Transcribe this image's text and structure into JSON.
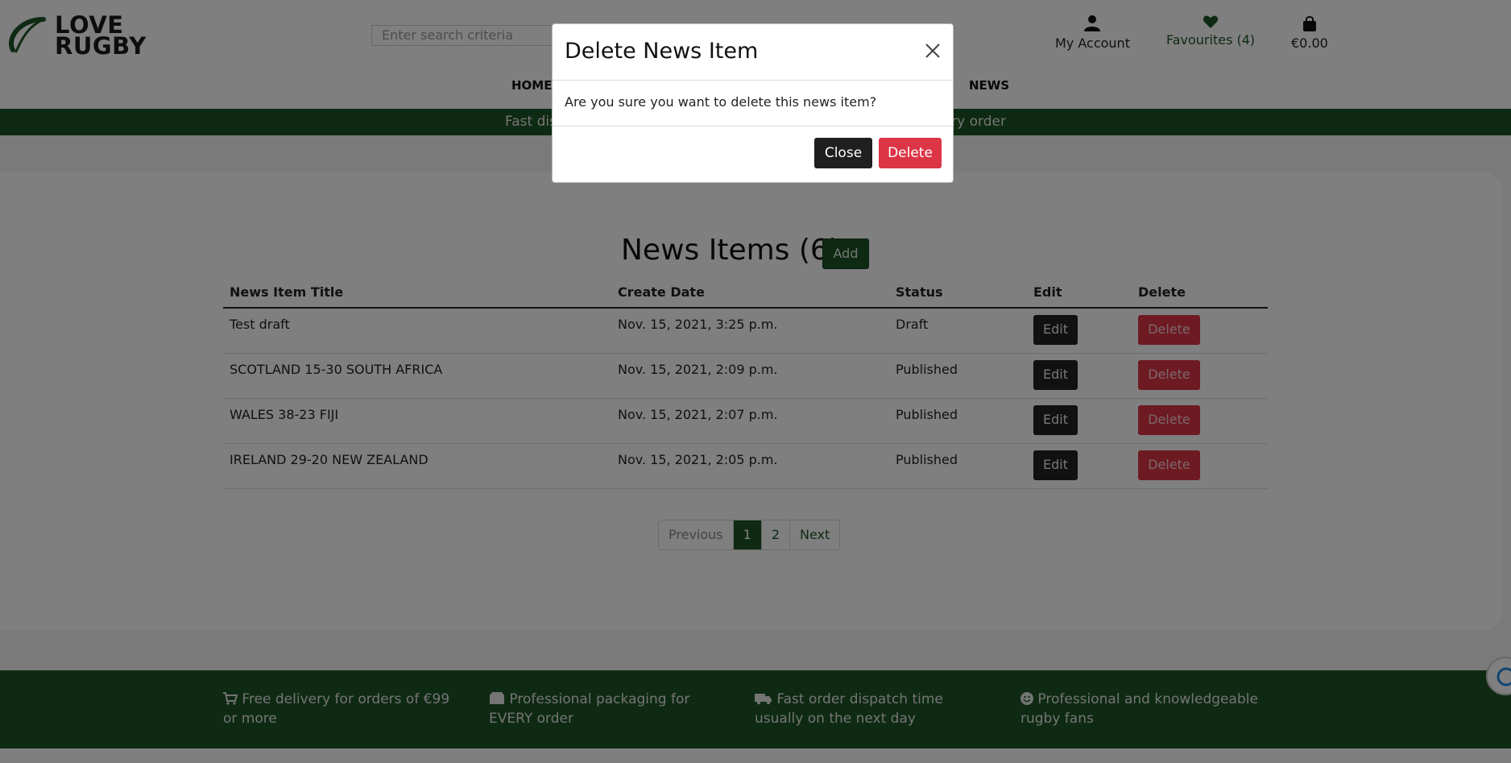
{
  "header": {
    "logo_line1": "LOVE",
    "logo_line2": "RUGBY",
    "search_placeholder": "Enter search criteria",
    "account_label": "My Account",
    "favourites_label": "Favourites (4)",
    "cart_label": "€0.00",
    "nav": {
      "home": "HOME",
      "news": "NEWS"
    }
  },
  "promo_text": "Fast dispatch - usually same day · Professional packaging for every order",
  "main": {
    "title": "News Items (6)",
    "add_label": "Add",
    "columns": [
      "News Item Title",
      "Create Date",
      "Status",
      "Edit",
      "Delete"
    ],
    "rows": [
      {
        "title": "Test draft",
        "date": "Nov. 15, 2021, 3:25 p.m.",
        "status": "Draft",
        "edit": "Edit",
        "delete": "Delete"
      },
      {
        "title": "SCOTLAND 15-30 SOUTH AFRICA",
        "date": "Nov. 15, 2021, 2:09 p.m.",
        "status": "Published",
        "edit": "Edit",
        "delete": "Delete"
      },
      {
        "title": "WALES 38-23 FIJI",
        "date": "Nov. 15, 2021, 2:07 p.m.",
        "status": "Published",
        "edit": "Edit",
        "delete": "Delete"
      },
      {
        "title": "IRELAND 29-20 NEW ZEALAND",
        "date": "Nov. 15, 2021, 2:05 p.m.",
        "status": "Published",
        "edit": "Edit",
        "delete": "Delete"
      }
    ],
    "pagination": {
      "previous": "Previous",
      "pages": [
        "1",
        "2"
      ],
      "current": "1",
      "next": "Next"
    }
  },
  "footer": {
    "items": [
      {
        "icon": "cart-icon",
        "text": "Free delivery for orders of €99 or more"
      },
      {
        "icon": "box-icon",
        "text": "Professional packaging for EVERY order"
      },
      {
        "icon": "truck-icon",
        "text": "Fast order dispatch time usually on the next day"
      },
      {
        "icon": "smile-icon",
        "text": "Professional and knowledgeable rugby fans"
      }
    ]
  },
  "modal": {
    "title": "Delete News Item",
    "body": "Are you sure you want to delete this news item?",
    "close_label": "Close",
    "delete_label": "Delete"
  },
  "colors": {
    "brand_green": "#1c5426",
    "danger": "#dc3545",
    "dark": "#222222"
  }
}
